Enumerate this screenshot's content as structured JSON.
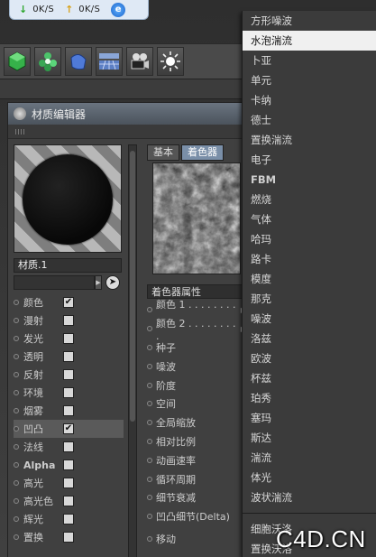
{
  "netbar": {
    "download_speed": "0K/S",
    "upload_speed": "0K/S"
  },
  "toolbar": {
    "icons": [
      "cube-icon",
      "gear-cluster-icon",
      "deformer-icon",
      "floor-icon",
      "camera-icon",
      "light-icon"
    ]
  },
  "window": {
    "title": "材质编辑器"
  },
  "material": {
    "name": "材质.1",
    "channels": [
      {
        "label": "颜色",
        "checked": true,
        "active": false
      },
      {
        "label": "漫射",
        "checked": false,
        "active": false
      },
      {
        "label": "发光",
        "checked": false,
        "active": false
      },
      {
        "label": "透明",
        "checked": false,
        "active": false
      },
      {
        "label": "反射",
        "checked": false,
        "active": false
      },
      {
        "label": "环境",
        "checked": false,
        "active": false
      },
      {
        "label": "烟雾",
        "checked": false,
        "active": false
      },
      {
        "label": "凹凸",
        "checked": true,
        "active": true
      },
      {
        "label": "法线",
        "checked": false,
        "active": false
      },
      {
        "label": "Alpha",
        "checked": false,
        "active": false
      },
      {
        "label": "高光",
        "checked": false,
        "active": false
      },
      {
        "label": "高光色",
        "checked": false,
        "active": false
      },
      {
        "label": "辉光",
        "checked": false,
        "active": false
      },
      {
        "label": "置换",
        "checked": false,
        "active": false
      }
    ]
  },
  "shader": {
    "tabs": [
      {
        "label": "基本",
        "selected": false
      },
      {
        "label": "着色器",
        "selected": true
      }
    ],
    "section_title": "着色器属性",
    "properties": [
      {
        "label": "颜色 1 . . . . . . . . .",
        "arrow": true
      },
      {
        "label": "颜色 2 . . . . . . . . .",
        "arrow": true
      },
      {
        "label": "种子",
        "arrow": false
      },
      {
        "label": "噪波",
        "arrow": false
      },
      {
        "label": "阶度",
        "arrow": false
      },
      {
        "label": "空间",
        "arrow": false
      },
      {
        "label": "全局缩放",
        "arrow": false
      },
      {
        "label": "相对比例",
        "arrow": false
      },
      {
        "label": "动画速率",
        "arrow": false
      },
      {
        "label": "循环周期",
        "arrow": false
      },
      {
        "label": "细节衰减",
        "arrow": false
      },
      {
        "label": "凹凸细节(Delta)",
        "arrow": false
      },
      {
        "label": "移动",
        "arrow": false
      }
    ]
  },
  "menu": {
    "items": [
      {
        "label": "方形噪波",
        "highlight": false,
        "bold": false
      },
      {
        "label": "水泡湍流",
        "highlight": true,
        "bold": false
      },
      {
        "label": "卜亚",
        "highlight": false,
        "bold": false
      },
      {
        "label": "单元",
        "highlight": false,
        "bold": false
      },
      {
        "label": "卡纳",
        "highlight": false,
        "bold": false
      },
      {
        "label": "德士",
        "highlight": false,
        "bold": false
      },
      {
        "label": "置换湍流",
        "highlight": false,
        "bold": false
      },
      {
        "label": "电子",
        "highlight": false,
        "bold": false
      },
      {
        "label": "FBM",
        "highlight": false,
        "bold": true
      },
      {
        "label": "燃烧",
        "highlight": false,
        "bold": false
      },
      {
        "label": "气体",
        "highlight": false,
        "bold": false
      },
      {
        "label": "哈玛",
        "highlight": false,
        "bold": false
      },
      {
        "label": "路卡",
        "highlight": false,
        "bold": false
      },
      {
        "label": "模度",
        "highlight": false,
        "bold": false
      },
      {
        "label": "那克",
        "highlight": false,
        "bold": false
      },
      {
        "label": "噪波",
        "highlight": false,
        "bold": false
      },
      {
        "label": "洛兹",
        "highlight": false,
        "bold": false
      },
      {
        "label": "欧波",
        "highlight": false,
        "bold": false
      },
      {
        "label": "杯兹",
        "highlight": false,
        "bold": false
      },
      {
        "label": "珀秀",
        "highlight": false,
        "bold": false
      },
      {
        "label": "塞玛",
        "highlight": false,
        "bold": false
      },
      {
        "label": "斯达",
        "highlight": false,
        "bold": false
      },
      {
        "label": "湍流",
        "highlight": false,
        "bold": false
      },
      {
        "label": "体光",
        "highlight": false,
        "bold": false
      },
      {
        "label": "波状湍流",
        "highlight": false,
        "bold": false
      }
    ],
    "items_after_sep": [
      {
        "label": "细胞沃洛",
        "highlight": false,
        "bold": false
      },
      {
        "label": "置换沃洛",
        "highlight": false,
        "bold": false
      }
    ]
  },
  "watermark": "C4D.CN"
}
